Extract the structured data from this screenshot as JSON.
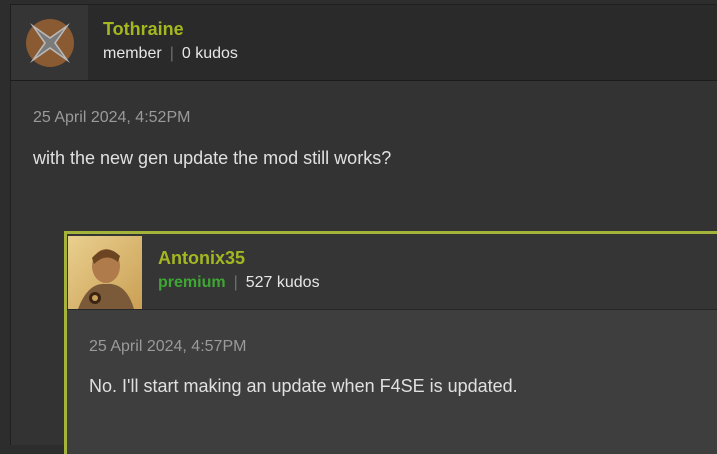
{
  "post": {
    "username": "Tothraine",
    "role": "member",
    "kudos": "0 kudos",
    "timestamp": "25 April 2024, 4:52PM",
    "body": "with the new gen update the mod still works?"
  },
  "reply": {
    "username": "Antonix35",
    "role": "premium",
    "kudos": "527 kudos",
    "timestamp": "25 April 2024, 4:57PM",
    "body": "No. I'll start making an update when F4SE is updated."
  },
  "colors": {
    "username": "#a4b720",
    "premium": "#3ea734",
    "reply_border": "#a4b33a"
  }
}
